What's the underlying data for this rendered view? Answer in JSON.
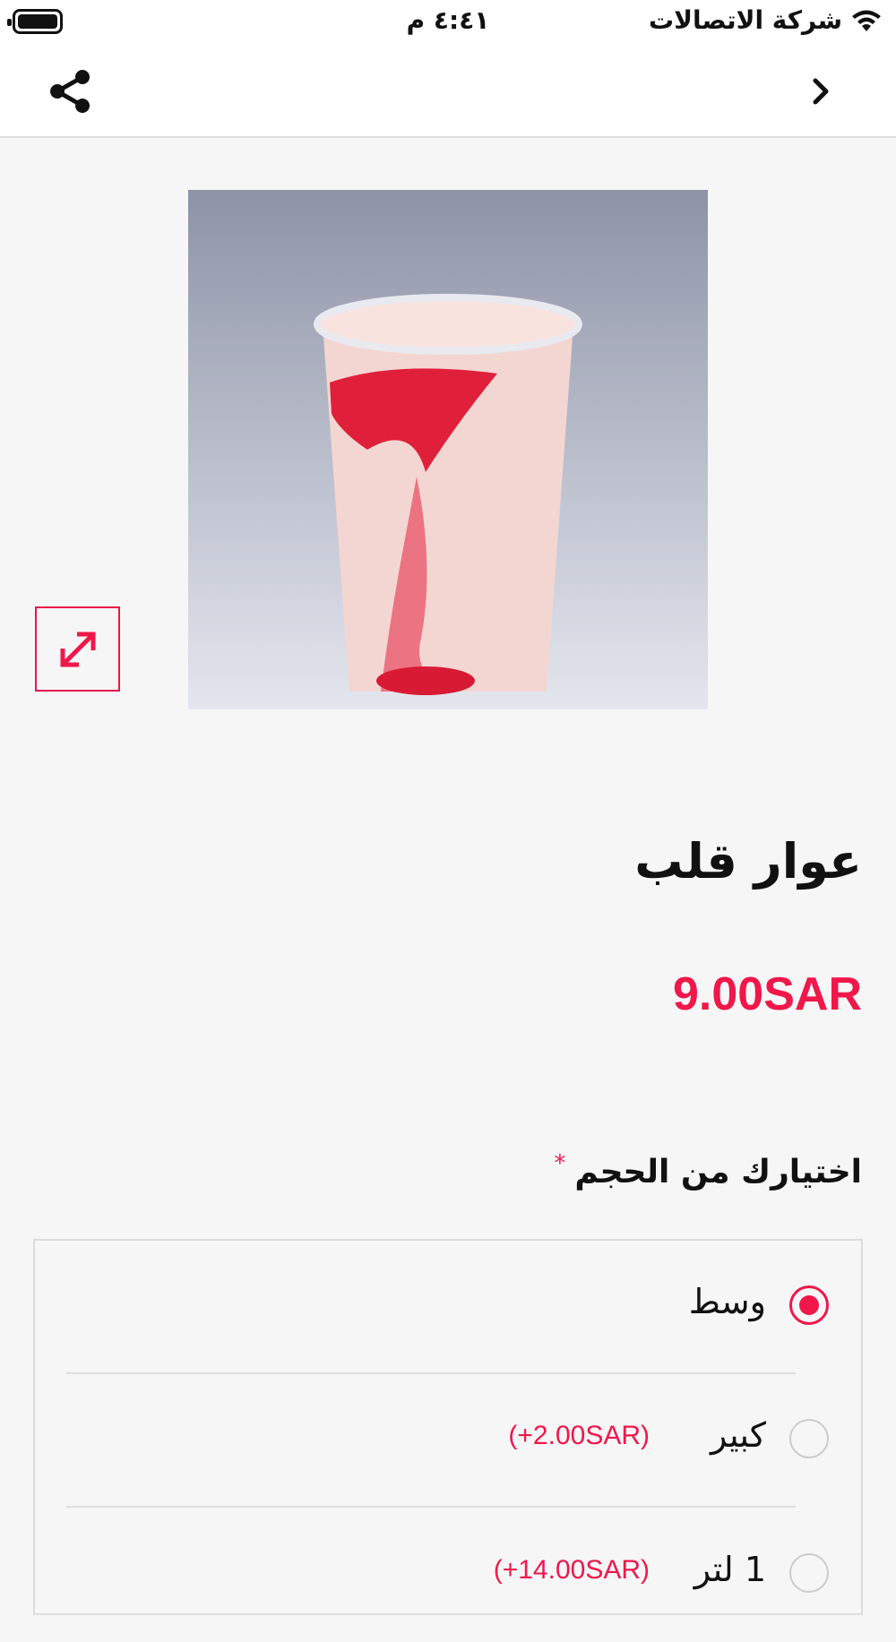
{
  "status_bar": {
    "carrier": "شركة الاتصالات",
    "time": "٤:٤١ م"
  },
  "nav": {
    "share_icon": "share-icon",
    "back_icon": "chevron-right-icon"
  },
  "product": {
    "name": "عوار قلب",
    "price": "9.00SAR",
    "expand_icon": "expand-arrows-icon"
  },
  "size_option": {
    "heading": "اختيارك من الحجم",
    "required_mark": "*",
    "options": [
      {
        "label": "وسط",
        "price": "",
        "selected": true
      },
      {
        "label": "كبير",
        "price": "(+2.00SAR)",
        "selected": false
      },
      {
        "label": "1 لتر",
        "price": "(+14.00SAR)",
        "selected": false
      }
    ]
  },
  "colors": {
    "accent": "#f0174b",
    "background": "#f6f6f6"
  }
}
